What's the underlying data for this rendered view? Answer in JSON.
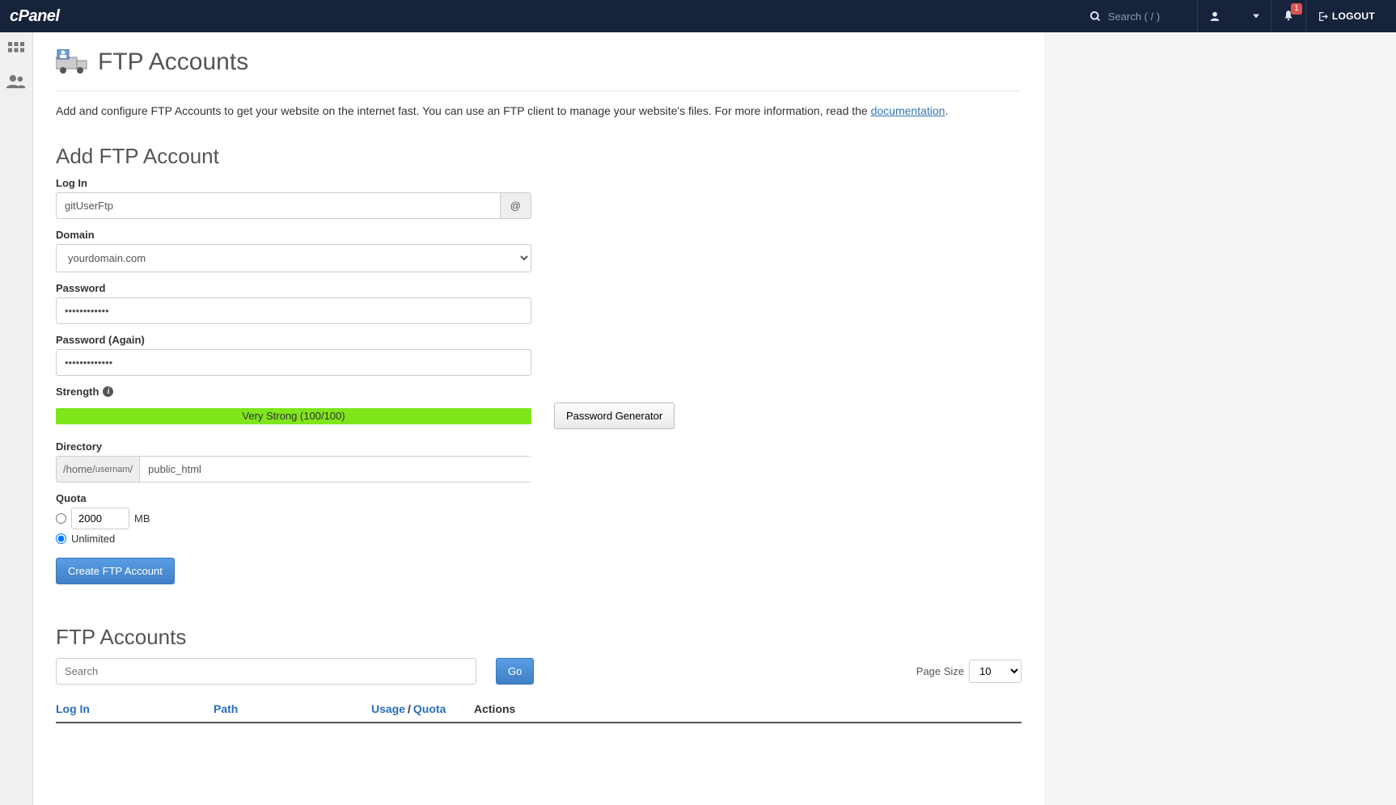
{
  "topbar": {
    "logo_text": "cPanel",
    "search_placeholder": "Search ( / )",
    "notification_count": "1",
    "logout_label": "LOGOUT"
  },
  "page": {
    "title": "FTP Accounts",
    "description_pre": "Add and configure FTP Accounts to get your website on the internet fast. You can use an FTP client to manage your website's files. For more information, read the ",
    "doc_link_label": "documentation",
    "description_post": "."
  },
  "add": {
    "heading": "Add FTP Account",
    "login_label": "Log In",
    "login_value": "gitUserFtp",
    "at_symbol": "@",
    "domain_label": "Domain",
    "domain_value": "yourdomain.com",
    "password_label": "Password",
    "password_value": "••••••••••••",
    "password_again_label": "Password (Again)",
    "password_again_value": "•••••••••••••",
    "strength_label": "Strength",
    "strength_text": "Very Strong (100/100)",
    "pw_gen_label": "Password Generator",
    "directory_label": "Directory",
    "directory_prefix_a": "/home/",
    "directory_prefix_b": "usernam",
    "directory_prefix_c": "/",
    "directory_value": "public_html",
    "quota_label": "Quota",
    "quota_value": "2000",
    "quota_unit": "MB",
    "quota_unlimited_label": "Unlimited",
    "create_button": "Create FTP Account"
  },
  "list": {
    "heading": "FTP Accounts",
    "search_placeholder": "Search",
    "go_label": "Go",
    "page_size_label": "Page Size",
    "page_size_value": "10",
    "col_login": "Log In",
    "col_path": "Path",
    "col_usage": "Usage",
    "col_quota": "Quota",
    "usage_sep": "/",
    "col_actions": "Actions"
  }
}
